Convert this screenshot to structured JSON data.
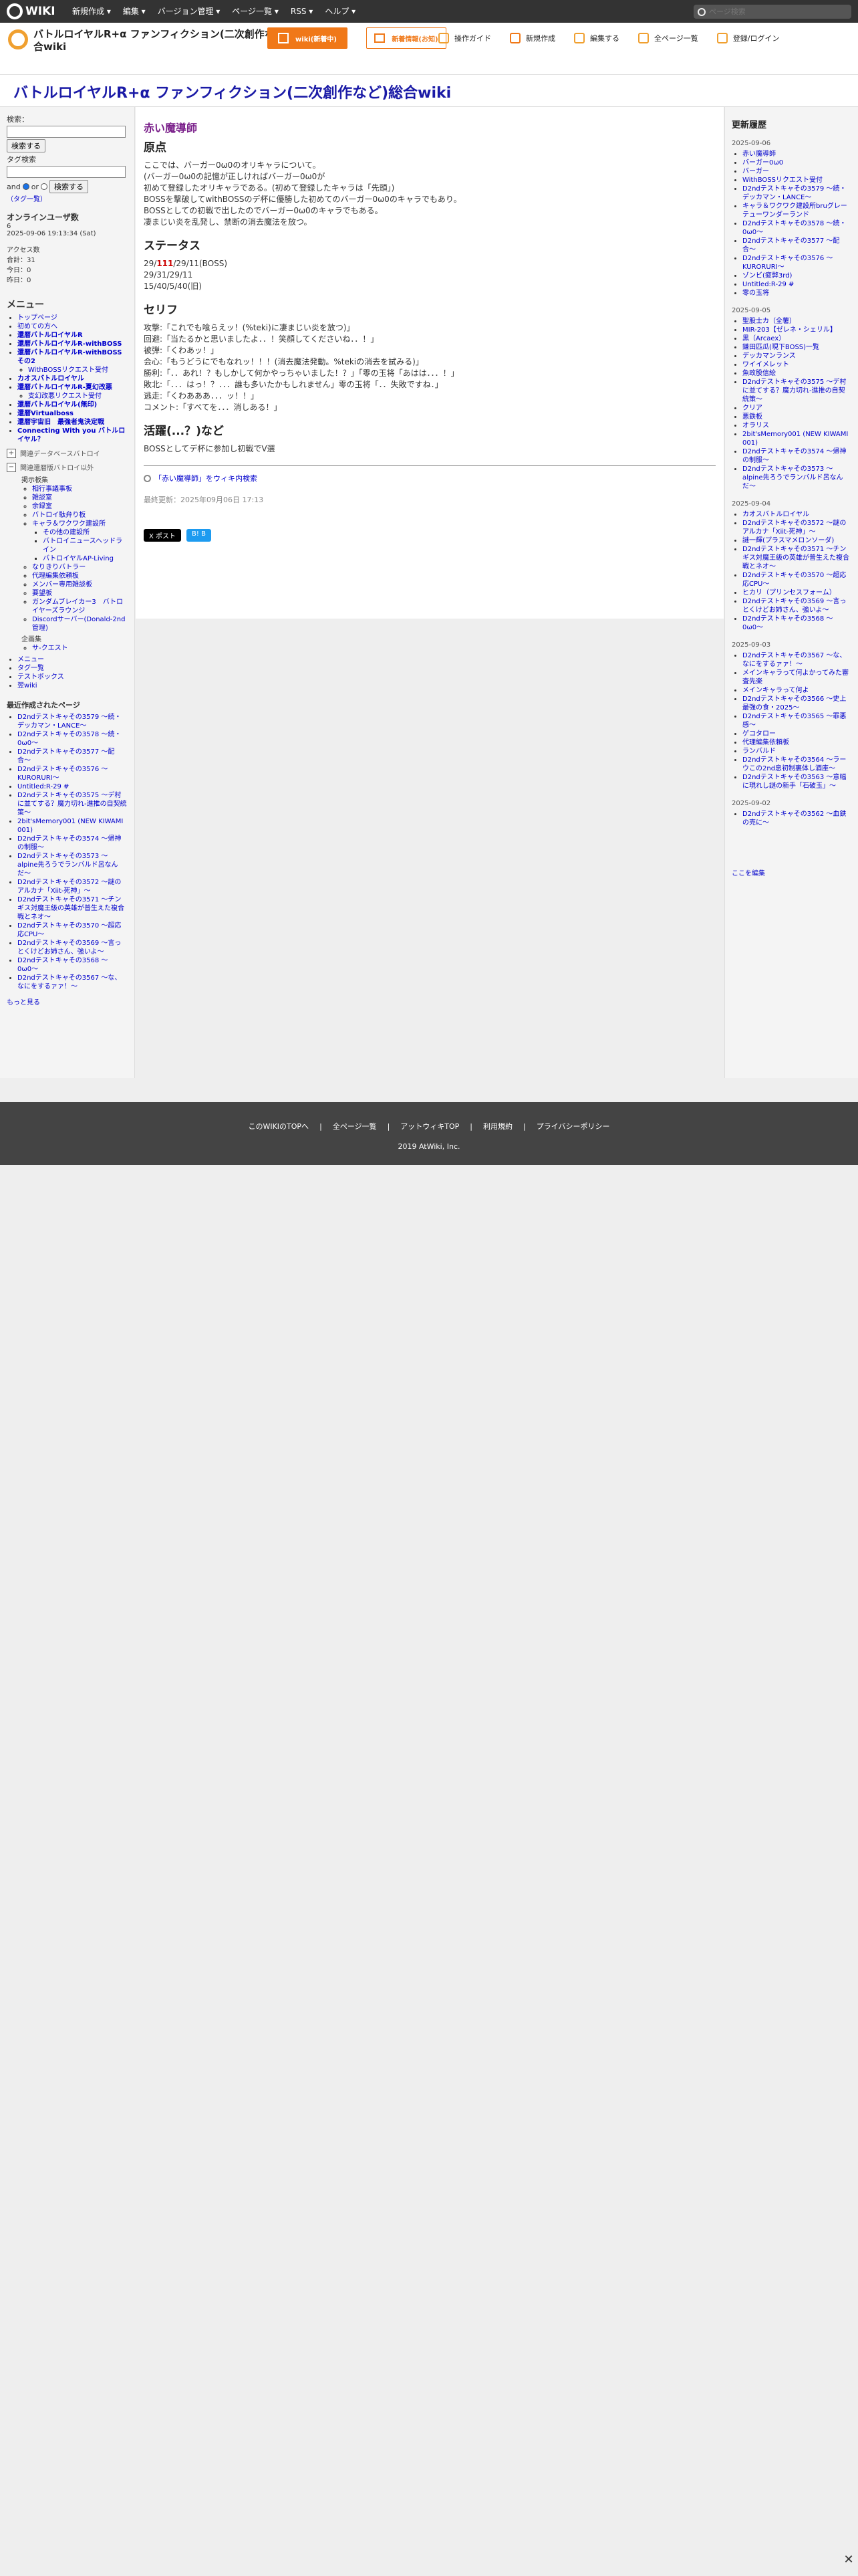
{
  "topbar": {
    "logo": "WIKI",
    "menu": [
      "新規作成 ▾",
      "編集 ▾",
      "バージョン管理 ▾",
      "ページ一覧 ▾",
      "RSS ▾",
      "ヘルプ ▾"
    ],
    "search_placeholder": "ページ検索"
  },
  "header": {
    "site_name": "バトルロイヤルR+α ファンフィクション(二次創作など)総合wiki",
    "edit_button": "wiki(新着中)",
    "news_button": "新着情報(お知)",
    "nav": [
      "操作ガイド",
      "新規作成",
      "編集する",
      "全ページ一覧",
      "登録/ログイン"
    ]
  },
  "page_title": "バトルロイヤルR+α ファンフィクション(二次創作など)総合wiki",
  "left": {
    "search_label": "検索：",
    "search_button": "検索する",
    "tag_label": "タグ検索",
    "and_label": "and",
    "or_label": "or",
    "tag_button": "検索する",
    "tag_note": "（タグ一覧）",
    "online_title": "オンラインユーザ数",
    "online_count": "6",
    "online_time": "2025-09-06 19:13:34 (Sat)",
    "access_title": "アクセス数",
    "access_total": "合計：31",
    "access_today": "今日：0",
    "access_yesterday": "昨日：0",
    "menu_title": "メニュー",
    "menu_items": [
      {
        "label": "トップページ",
        "bold": false
      },
      {
        "label": "初めての方へ",
        "bold": false
      },
      {
        "label": "還暦バトルロイヤルR",
        "bold": true
      },
      {
        "label": "還暦バトルロイヤルR-withBOSS",
        "bold": true
      },
      {
        "label": "還暦バトルロイヤルR-withBOSSその2",
        "bold": true
      }
    ],
    "menu_sub1": [
      "WithBOSSリクエスト受付"
    ],
    "menu_items2": [
      {
        "label": "カオスバトルロイヤル",
        "bold": true
      },
      {
        "label": "還暦バトルロイヤルR-夏幻改悪",
        "bold": true
      }
    ],
    "menu_sub2": [
      "支幻改悪リクエスト受付"
    ],
    "menu_items3": [
      {
        "label": "還暦バトルロイヤル(無印)",
        "bold": true
      },
      {
        "label": "還暦Virtualboss",
        "bold": true
      },
      {
        "label": "還暦宇宙旧　最強者鬼決定戦",
        "bold": true
      },
      {
        "label": "Connecting With you バトルロイヤル？",
        "bold": true
      }
    ],
    "tree1": "関連データベースバトロイ",
    "tree2": "関連還暦版バトロイ以外",
    "tree_sub_title": "掲示板集",
    "tree_sub": [
      "相行事議事板",
      "雑談室",
      "余録室",
      "バトロイ駄弁り板",
      "キャラ＆ワクワク建設所"
    ],
    "tree_sub2": [
      "その他の建設所",
      "バトロイニュースヘッドライン",
      "バトロイヤルAP-Living"
    ],
    "tree_sub3": [
      "なりきりバトラー",
      "代理編集依頼板",
      "メンバー専用雑談板",
      "要望板",
      "ガンダムブレイカー3　バトロイヤーズラウンジ",
      "Discordサーバー(Donald-2nd管理)"
    ],
    "plan_title": "企画集",
    "plan_items": [
      "サ-クエスト"
    ],
    "extra": [
      "メニュー",
      "タグ一覧",
      "テストボックス",
      "翌wiki"
    ],
    "recent_title": "最近作成されたページ",
    "recent": [
      "D2ndテストキャその3579 〜続・デッカマン・LANCE〜",
      "D2ndテストキャその3578 〜続・0ω0〜",
      "D2ndテストキャその3577 〜配合〜",
      "D2ndテストキャその3576 〜KURORURI〜",
      "Untitled:R-29 #",
      "D2ndテストキャその3575 〜デ村に並てする？魔力切れ-進推の自契統策〜",
      "2bit'sMemory001 (NEW KIWAMI 001)",
      "D2ndテストキャその3574 〜帰神の制服〜",
      "D2ndテストキャその3573 〜alpine先ろうでランバルド呂なんだ〜",
      "D2ndテストキャその3572 〜謎のアルカナ「Xiit-死神」〜",
      "D2ndテストキャその3571 〜チンギス対魔王級の英雄が普生えた複合戦とネオ〜",
      "D2ndテストキャその3570 〜超応応CPU〜",
      "D2ndテストキャその3569 〜言っとくけどお姉さん、強いよ〜",
      "D2ndテストキャその3568 〜0ω0〜",
      "D2ndテストキャその3567 〜な、なにをするァァ！〜"
    ],
    "more": "もっと見る"
  },
  "main": {
    "page_name": "赤い魔導師",
    "h_origin": "原点",
    "origin_lines": [
      "ここでは、バーガー0ω0のオリキャラについて。",
      "(バーガー0ω0の記憶が正しければバーガー0ω0が",
      "初めて登録したオリキャラである。(初めて登録したキャラは「先頭」)",
      "BOSSを撃破してwithBOSSのデ杯に優勝した初めてのバーガー0ω0のキャラでもあり。",
      "BOSSとしての初戦で出したのでバーガー0ω0のキャラでもある。",
      "凄まじい炎を乱発し、禁断の消去魔法を放つ。"
    ],
    "h_status": "ステータス",
    "status_1_pre": "29/",
    "status_1_red": "111",
    "status_1_post": "/29/11(BOSS)",
    "status_2": "29/31/29/11",
    "status_3": "15/40/5/40(旧)",
    "h_lines": "セリフ",
    "lines": [
      "攻撃:「これでも喰らえッ！(%teki)に凄まじい炎を放つ)」",
      "回避:「当たるかと思いましたよ．．！笑顔してくださいね．．！」",
      "被弾:「くわあッ！」",
      "会心:「もうどうにでもなれッ！！！(消去魔法発動。%tekiの消去を試みる)」",
      "勝利:「．．あれ！？もしかして何かやっちゃいました！？」「零の玉将「あはは．．．！」",
      "敗北:「．．．はっ！？．．．誰も多いたかもしれません」零の玉将「．．失敗ですね．」",
      "逃走:「くわあああ．．．ッ！！」",
      "コメント:「すべてを．．．消しある！」"
    ],
    "h_activity": "活躍(...？)など",
    "activity": "BOSSとしてデ杯に参加し初戦でV選",
    "wiki_search": "「赤い魔導師」をウィキ内検索",
    "last_update": "最終更新：2025年09月06日 17:13",
    "share_x": "X ポスト",
    "share_b": "B! B"
  },
  "right": {
    "title": "更新履歴",
    "groups": [
      {
        "date": "2025-09-06",
        "items": [
          "赤い魔導師",
          "バーガー0ω0",
          "バーガー",
          "WithBOSSリクエスト受付",
          "D2ndテストキャその3579 〜続・デッカマン・LANCE〜",
          "キャラ＆ワクワク建設所bruグレーテューワンダーランド",
          "D2ndテストキャその3578 〜続・0ω0〜",
          "D2ndテストキャその3577 〜配合〜",
          "D2ndテストキャその3576 〜KURORURI〜",
          "ゾンビ(疲弊3rd)",
          "Untitled:R-29 #",
          "零の玉将"
        ]
      },
      {
        "date": "2025-09-05",
        "items": [
          "聖股士カ（全薯）",
          "MIR-203【ゼレネ・シェリル】",
          "黒（Arcaex）",
          "鎌田匹瓜(現下BOSS)一覧",
          "デッカマンランス",
          "ワイイメレット",
          "魚政股信絵",
          "D2ndテストキャその3575 〜デ村に並てする？魔力切れ-進推の自契統策〜",
          "クリア",
          "悪鉄板",
          "オラリス",
          "2bit'sMemory001 (NEW KIWAMI 001)",
          "D2ndテストキャその3574 〜帰神の制服〜",
          "D2ndテストキャその3573 〜alpine先ろうでランバルド呂なんだ〜"
        ]
      },
      {
        "date": "2025-09-04",
        "items": [
          "カオスバトルロイヤル",
          "D2ndテストキャその3572 〜謎のアルカナ「Xiit-死神」〜",
          "謎一輝(プラスマメロンソーダ)",
          "D2ndテストキャその3571 〜チンギス対魔王級の英雄が普生えた複合戦とネオ〜",
          "D2ndテストキャその3570 〜超応応CPU〜",
          "ヒカリ（プリンセスフォーム）",
          "D2ndテストキャその3569 〜言っとくけどお姉さん、強いよ〜",
          "D2ndテストキャその3568 〜0ω0〜"
        ]
      },
      {
        "date": "2025-09-03",
        "items": [
          "D2ndテストキャその3567 〜な、なにをするァァ！〜",
          "メインキャラって何よかってみた審査先楽",
          "メインキャラって何よ",
          "D2ndテストキャその3566 〜史上最強の食・2025〜",
          "D2ndテストキャその3565 〜罪悪感〜",
          "ゲコタロー",
          "代理編集依頼板",
          "ランバルド",
          "D2ndテストキャその3564 〜ラーウこの2nd息初制裏体し酒座〜",
          "D2ndテストキャその3563 〜意幅に現れし謎の新手「石破玉」〜"
        ]
      },
      {
        "date": "2025-09-02",
        "items": [
          "D2ndテストキャその3562 〜血鉄の売に〜"
        ]
      }
    ],
    "edit_here": "ここを編集"
  },
  "footer": {
    "links": [
      "このWIKIのTOPへ",
      "全ページ一覧",
      "アットウィキTOP",
      "利用規約",
      "プライバシーポリシー"
    ],
    "copyright": "2019 AtWiki, Inc."
  }
}
